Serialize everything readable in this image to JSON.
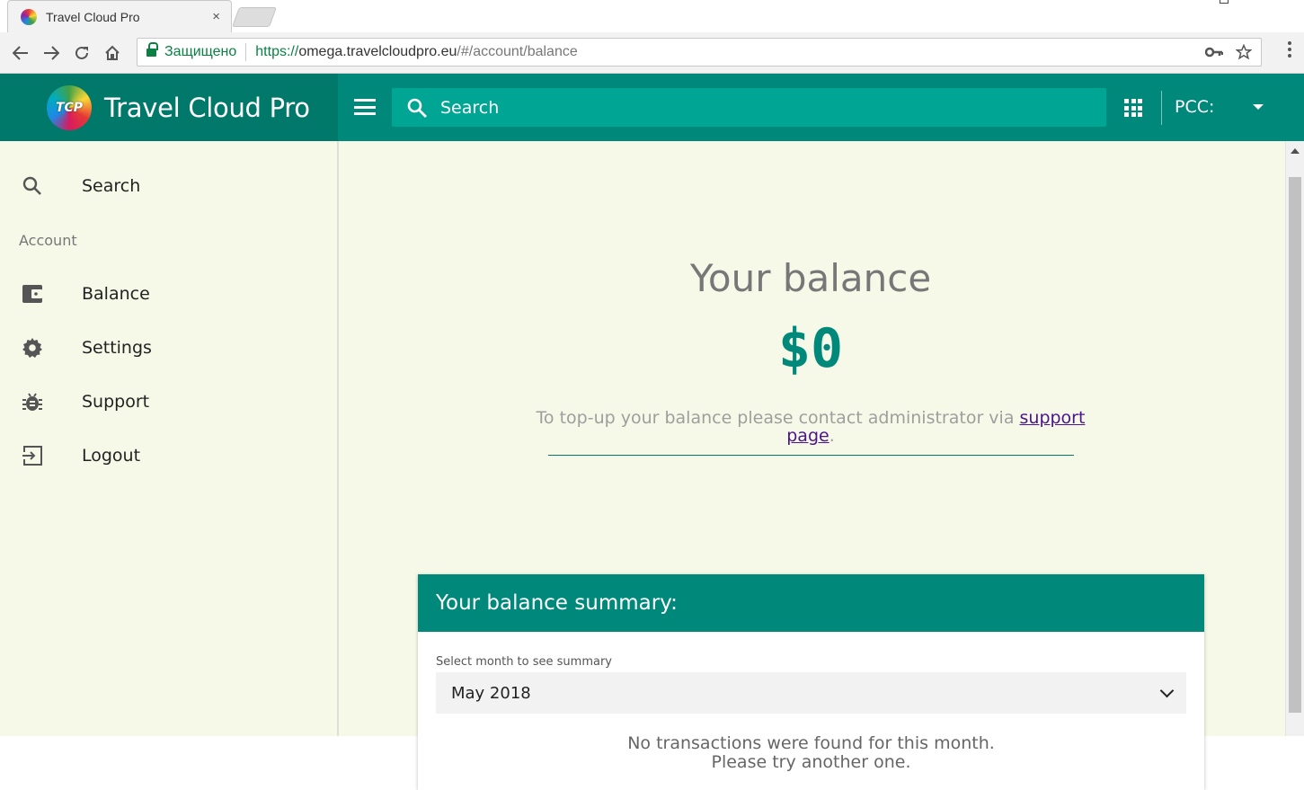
{
  "browser": {
    "tab_title": "Travel Cloud Pro",
    "tab_close": "×",
    "secure_label": "Защищено",
    "url_scheme": "https://",
    "url_host": "omega.travelcloudpro.eu",
    "url_path": "/#/account/balance",
    "icons": [
      "back-icon",
      "forward-icon",
      "reload-icon",
      "home-icon",
      "lock-icon",
      "key-icon",
      "star-icon",
      "menu-icon"
    ]
  },
  "header": {
    "brand_logo_text": "TCP",
    "brand_name": "Travel Cloud Pro",
    "search_placeholder": "Search",
    "pcc_label": "PCC:",
    "colors": {
      "primary": "#00897b",
      "brand_dark": "#00796b",
      "search_bg": "#00a693"
    }
  },
  "sidebar": {
    "search_label": "Search",
    "section_title": "Account",
    "items": [
      {
        "label": "Balance",
        "icon": "wallet-icon"
      },
      {
        "label": "Settings",
        "icon": "gear-icon"
      },
      {
        "label": "Support",
        "icon": "bug-icon"
      },
      {
        "label": "Logout",
        "icon": "logout-icon"
      }
    ]
  },
  "main": {
    "balance_title": "Your balance",
    "balance_amount": "$0",
    "topup_text": "To top-up your balance please contact administrator via ",
    "topup_link": "support page",
    "topup_end": ".",
    "summary_title": "Your balance summary:",
    "month_label": "Select month to see summary",
    "month_value": "May 2018",
    "empty_line1": "No transactions were found for this month.",
    "empty_line2": "Please try another one.",
    "colors": {
      "accent": "#00897b",
      "link": "#4a148c",
      "page_bg": "#f7f9e8"
    }
  }
}
